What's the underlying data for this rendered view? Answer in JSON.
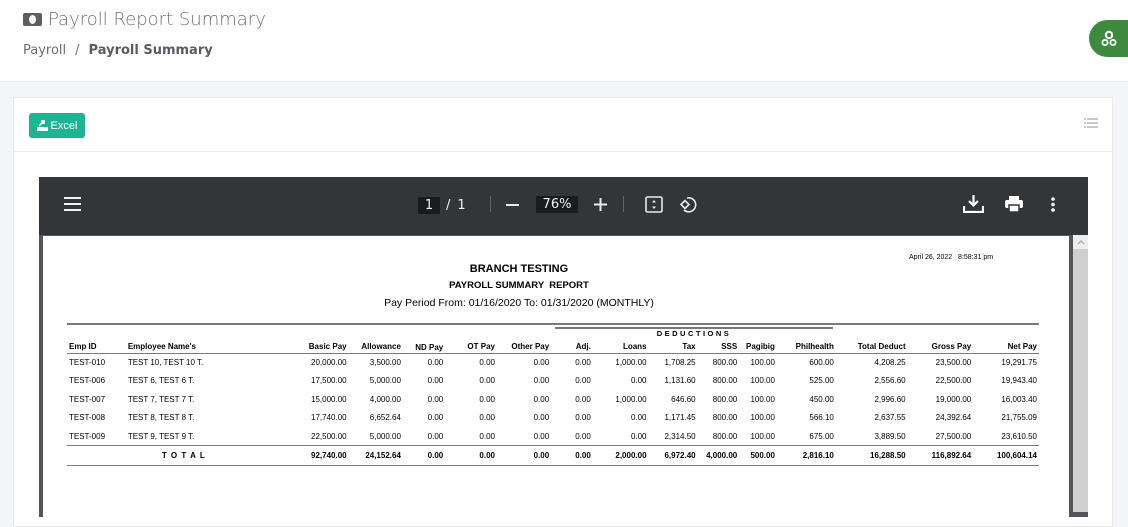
{
  "header": {
    "title": "Payroll Report Summary",
    "title_icon": "money-bill-icon",
    "breadcrumb": [
      {
        "label": "Payroll"
      },
      {
        "label": "Payroll Summary"
      }
    ],
    "breadcrumb_separator": "/",
    "settings_icon": "cogs-icon"
  },
  "toolbar": {
    "excel_label": "Excel",
    "list_icon": "list-icon"
  },
  "viewer": {
    "current_page": "1",
    "page_separator": "/",
    "total_pages": "1",
    "zoom": "76%"
  },
  "report": {
    "timestamp_date": "April 26, 2022",
    "timestamp_time": "8:58:31 pm",
    "company": "BRANCH TESTING",
    "title": "PAYROLL SUMMARY  REPORT",
    "period": "Pay Period From: 01/16/2020 To: 01/31/2020 (MONTHLY)",
    "deductions_label": "DEDUCTIONS",
    "columns": [
      "Emp ID",
      "Employee Name's",
      "Basic Pay",
      "Allowance",
      "ND Pay",
      "OT Pay",
      "Other Pay",
      "Adj.",
      "Loans",
      "Tax",
      "SSS",
      "Pagibig",
      "Philhealth",
      "Total Deduct",
      "Gross Pay",
      "Net Pay"
    ],
    "rows": [
      [
        "TEST-010",
        "TEST 10, TEST 10 T.",
        "20,000.00",
        "3,500.00",
        "0.00",
        "0.00",
        "0.00",
        "0.00",
        "1,000.00",
        "1,708.25",
        "800.00",
        "100.00",
        "600.00",
        "4,208.25",
        "23,500.00",
        "19,291.75"
      ],
      [
        "TEST-006",
        "TEST 6, TEST 6 T.",
        "17,500.00",
        "5,000.00",
        "0.00",
        "0.00",
        "0.00",
        "0.00",
        "0.00",
        "1,131.60",
        "800.00",
        "100.00",
        "525.00",
        "2,556.60",
        "22,500.00",
        "19,943.40"
      ],
      [
        "TEST-007",
        "TEST 7, TEST 7 T.",
        "15,000.00",
        "4,000.00",
        "0.00",
        "0.00",
        "0.00",
        "0.00",
        "1,000.00",
        "646.60",
        "800.00",
        "100.00",
        "450.00",
        "2,996.60",
        "19,000.00",
        "16,003.40"
      ],
      [
        "TEST-008",
        "TEST 8, TEST 8 T.",
        "17,740.00",
        "6,652.64",
        "0.00",
        "0.00",
        "0.00",
        "0.00",
        "0.00",
        "1,171.45",
        "800.00",
        "100.00",
        "566.10",
        "2,637.55",
        "24,392.64",
        "21,755.09"
      ],
      [
        "TEST-009",
        "TEST 9, TEST 9 T.",
        "22,500.00",
        "5,000.00",
        "0.00",
        "0.00",
        "0.00",
        "0.00",
        "0.00",
        "2,314.50",
        "800.00",
        "100.00",
        "675.00",
        "3,889.50",
        "27,500.00",
        "23,610.50"
      ]
    ],
    "total_label": "T O T A L",
    "totals": [
      "92,740.00",
      "24,152.64",
      "0.00",
      "0.00",
      "0.00",
      "0.00",
      "2,000.00",
      "6,972.40",
      "4,000.00",
      "500.00",
      "2,816.10",
      "16,288.50",
      "116,892.64",
      "100,604.14"
    ]
  },
  "colors": {
    "excel_button": "#1cb493",
    "settings_button": "#3d8a3f",
    "viewer_toolbar": "#323639"
  }
}
